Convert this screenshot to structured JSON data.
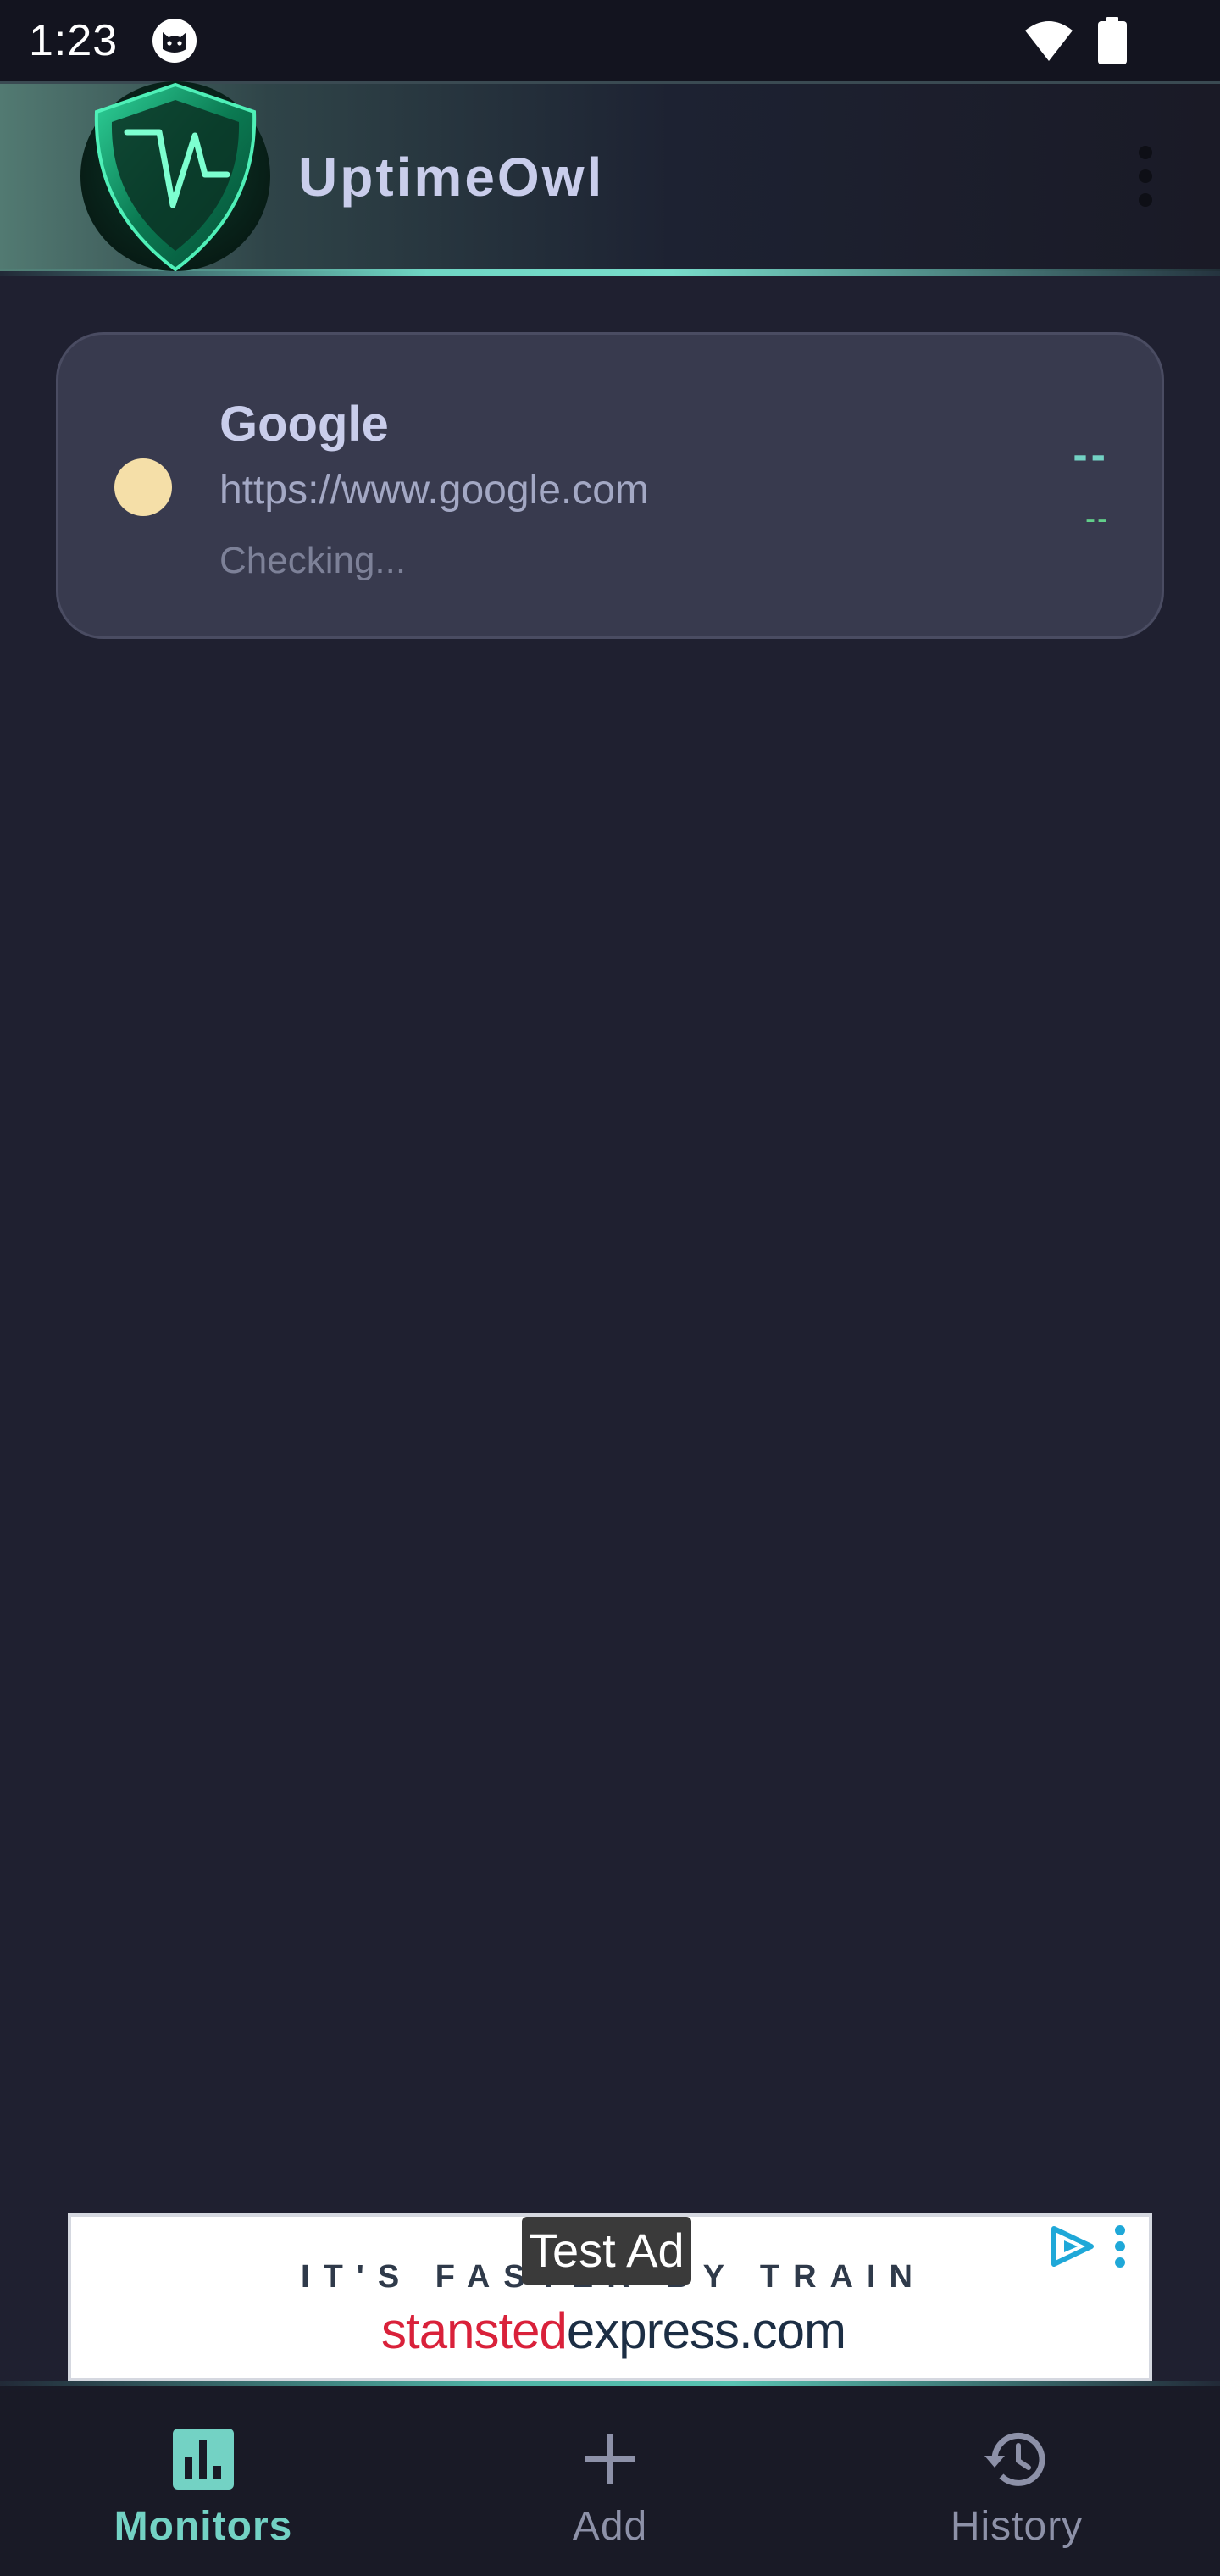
{
  "status_bar": {
    "time": "1:23"
  },
  "app_bar": {
    "title": "UptimeOwl"
  },
  "monitors": [
    {
      "name": "Google",
      "url": "https://www.google.com",
      "status": "Checking...",
      "response": "--",
      "uptime": "--",
      "dot_color": "#f5dfa8"
    }
  ],
  "ad": {
    "label": "Test Ad",
    "tagline": "IT'S FASTER BY TRAIN",
    "brand_part1": "stansted",
    "brand_part2": "express.com"
  },
  "bottom_nav": {
    "items": [
      {
        "label": "Monitors",
        "icon": "bar-chart-icon",
        "active": true
      },
      {
        "label": "Add",
        "icon": "plus-icon",
        "active": false
      },
      {
        "label": "History",
        "icon": "history-icon",
        "active": false
      }
    ]
  },
  "colors": {
    "background": "#1f2030",
    "accent": "#73d2c4",
    "card": "#383a4e",
    "pending_dot": "#f5dfa8"
  }
}
